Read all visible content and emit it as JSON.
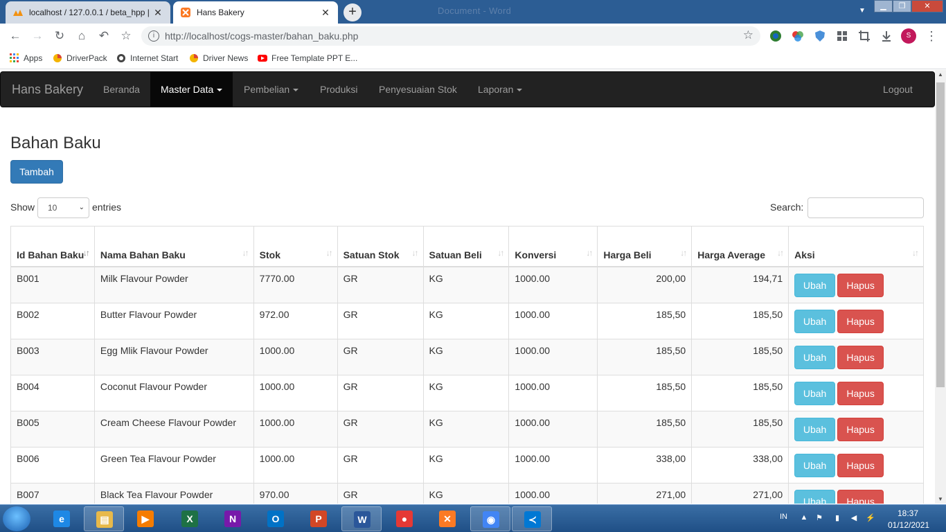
{
  "browser": {
    "tabs": [
      {
        "title": "localhost / 127.0.0.1 / beta_hpp |",
        "favicon": "phpmyadmin-icon",
        "active": false
      },
      {
        "title": "Hans Bakery",
        "favicon": "xampp-icon",
        "active": true
      }
    ],
    "new_tab": "+",
    "ghost_title": "Document - Word",
    "url": "http://localhost/cogs-master/bahan_baku.php",
    "profile_initial": "S",
    "bookmarks": [
      "Apps",
      "DriverPack",
      "Internet Start",
      "Driver News",
      "Free Template PPT E..."
    ]
  },
  "navbar": {
    "brand": "Hans Bakery",
    "items": [
      "Beranda",
      "Master Data",
      "Pembelian",
      "Produksi",
      "Penyesuaian Stok",
      "Laporan"
    ],
    "logout": "Logout"
  },
  "page": {
    "title": "Bahan Baku",
    "add_button": "Tambah",
    "show_label": "Show",
    "entries_value": "10",
    "entries_label": "entries",
    "search_label": "Search:",
    "search_value": ""
  },
  "table": {
    "headers": [
      "Id Bahan Baku",
      "Nama Bahan Baku",
      "Stok",
      "Satuan Stok",
      "Satuan Beli",
      "Konversi",
      "Harga Beli",
      "Harga Average",
      "Aksi"
    ],
    "edit_label": "Ubah",
    "delete_label": "Hapus",
    "rows": [
      [
        "B001",
        "Milk Flavour Powder",
        "7770.00",
        "GR",
        "KG",
        "1000.00",
        "200,00",
        "194,71"
      ],
      [
        "B002",
        "Butter Flavour Powder",
        "972.00",
        "GR",
        "KG",
        "1000.00",
        "185,50",
        "185,50"
      ],
      [
        "B003",
        "Egg Mlik Flavour Powder",
        "1000.00",
        "GR",
        "KG",
        "1000.00",
        "185,50",
        "185,50"
      ],
      [
        "B004",
        "Coconut Flavour Powder",
        "1000.00",
        "GR",
        "KG",
        "1000.00",
        "185,50",
        "185,50"
      ],
      [
        "B005",
        "Cream Cheese Flavour Powder",
        "1000.00",
        "GR",
        "KG",
        "1000.00",
        "185,50",
        "185,50"
      ],
      [
        "B006",
        "Green Tea Flavour Powder",
        "1000.00",
        "GR",
        "KG",
        "1000.00",
        "338,00",
        "338,00"
      ],
      [
        "B007",
        "Black Tea Flavour Powder",
        "970.00",
        "GR",
        "KG",
        "1000.00",
        "271,00",
        "271,00"
      ]
    ]
  },
  "taskbar": {
    "lang": "IN",
    "time": "18:37",
    "date": "01/12/2021",
    "apps": [
      "explorer-icon",
      "media-player-icon",
      "excel-icon",
      "onenote-icon",
      "outlook-icon",
      "powerpoint-icon",
      "word-icon",
      "app-red-icon",
      "xampp-icon",
      "chrome-icon",
      "vscode-icon"
    ]
  },
  "colors": {
    "primary": "#337ab7",
    "info": "#5bc0de",
    "danger": "#d9534f",
    "navbar": "#222222"
  }
}
